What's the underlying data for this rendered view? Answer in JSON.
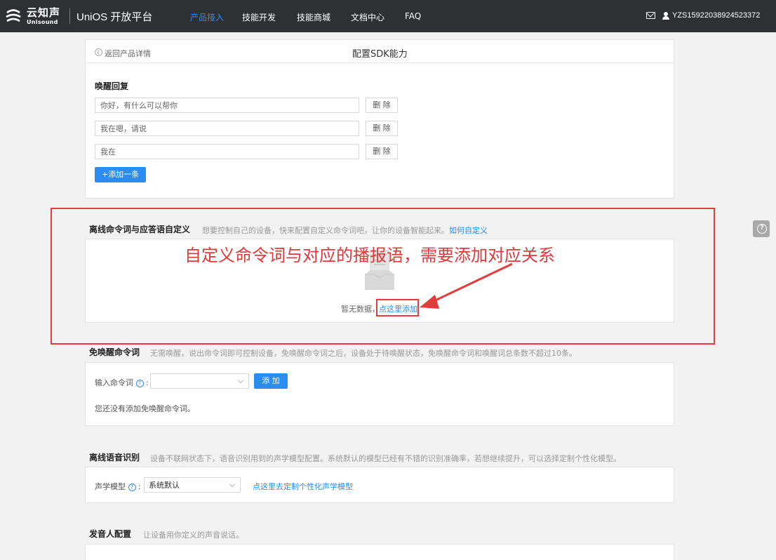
{
  "header": {
    "logo_cn": "云知声",
    "logo_en": "Unisound",
    "platform": "UniOS 开放平台",
    "nav": [
      "产品接入",
      "技能开发",
      "技能商城",
      "文档中心",
      "FAQ"
    ],
    "active_nav": "产品接入",
    "username": "YZS15922038924523372"
  },
  "page": {
    "back": "返回产品详情",
    "title": "配置SDK能力"
  },
  "wake_reply": {
    "title": "唤醒回复",
    "items": [
      "你好，有什么可以帮你",
      "我在嗯，请说",
      "我在"
    ],
    "delete_label": "删 除",
    "add_label": "+添加一条"
  },
  "offline_command": {
    "title": "离线命令词与应答语自定义",
    "desc": "想要控制自己的设备，快来配置自定义命令词吧，让你的设备智能起来。",
    "desc_link": "如何自定义",
    "empty_text": "暂无数据，",
    "add_link": "点这里添加",
    "annotation": "自定义命令词与对应的播报语，需要添加对应关系"
  },
  "wakeless": {
    "title": "免唤醒命令词",
    "desc": "无需唤醒，说出命令词即可控制设备，免唤醒命令词之后，设备处于待唤醒状态，免唤醒命令词和唤醒词总条数不超过10条。",
    "input_label": "输入命令词",
    "add_button": "添 加",
    "empty_text": "您还没有添加免唤醒命令词。"
  },
  "offline_asr": {
    "title": "离线语音识别",
    "desc": "设备不联网状态下，语音识别用到的声学模型配置。系统默认的模型已经有不错的识别准确率，若想继续提升，可以选择定制个性化模型。",
    "model_label": "声学模型",
    "model_value": "系统默认",
    "custom_link": "点这里去定制个性化声学模型"
  },
  "speaker": {
    "title": "发音人配置",
    "desc": "让设备用你定义的声音说话。"
  },
  "colors": {
    "accent": "#2d8cf0",
    "annotation": "#e23c3c",
    "topbar": "#2f3033"
  }
}
